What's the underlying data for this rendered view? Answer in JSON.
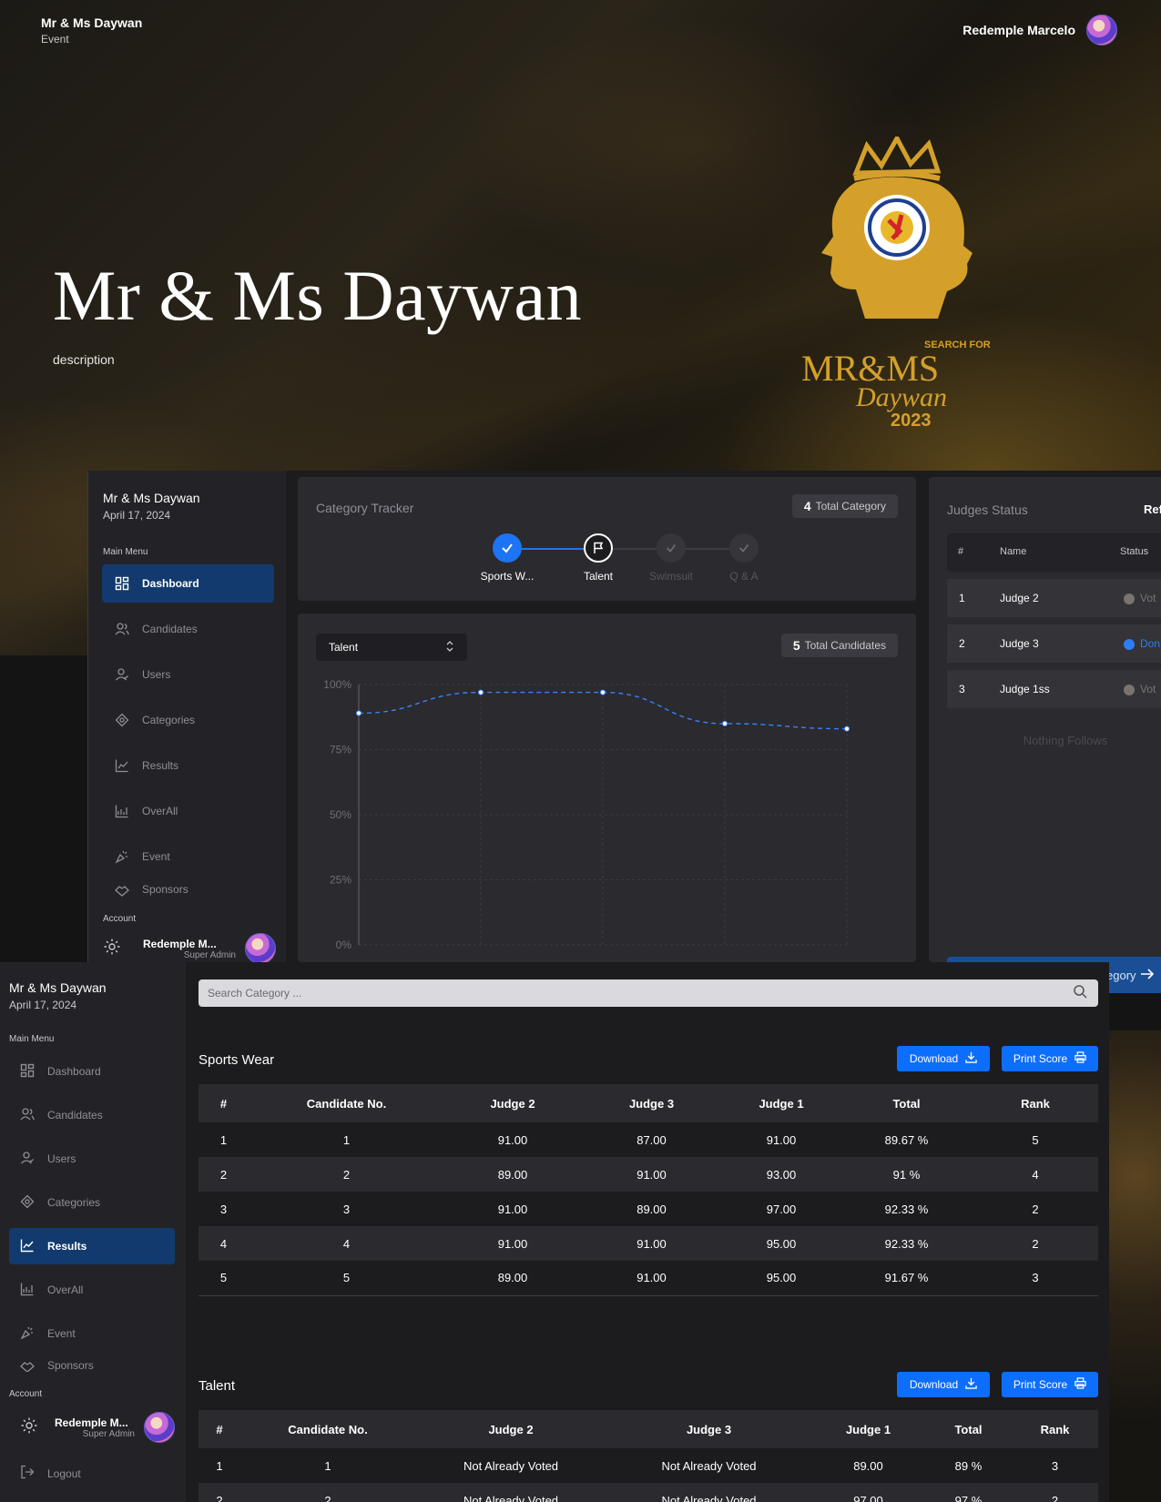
{
  "hero": {
    "brand_title": "Mr & Ms Daywan",
    "brand_sub": "Event",
    "user_name": "Redemple Marcelo",
    "title": "Mr & Ms Daywan",
    "description": "description",
    "logo": {
      "line1": "SEARCH FOR",
      "line2": "MR&MS",
      "line3": "Daywan",
      "year": "2023"
    }
  },
  "dashboard": {
    "app_title": "Mr & Ms Daywan",
    "app_date": "April 17, 2024",
    "main_menu_label": "Main Menu",
    "menu": [
      {
        "label": "Dashboard",
        "icon": "dashboard-icon"
      },
      {
        "label": "Candidates",
        "icon": "candidates-icon"
      },
      {
        "label": "Users",
        "icon": "users-icon"
      },
      {
        "label": "Categories",
        "icon": "categories-icon"
      },
      {
        "label": "Results",
        "icon": "results-icon"
      },
      {
        "label": "OverAll",
        "icon": "overall-icon"
      },
      {
        "label": "Event",
        "icon": "event-icon"
      },
      {
        "label": "Sponsors",
        "icon": "sponsors-icon"
      }
    ],
    "active_item": "Dashboard",
    "account_label": "Account",
    "account_name": "Redemple M...",
    "account_role": "Super Admin",
    "tracker": {
      "title": "Category Tracker",
      "total_count": "4",
      "total_label": "Total Category",
      "steps": [
        {
          "label": "Sports W...",
          "state": "done"
        },
        {
          "label": "Talent",
          "state": "current"
        },
        {
          "label": "Swimsuit",
          "state": "pending"
        },
        {
          "label": "Q & A",
          "state": "pending"
        }
      ]
    },
    "chart_card": {
      "selected_category": "Talent",
      "total_count": "5",
      "total_label": "Total Candidates"
    },
    "judges": {
      "title": "Judges Status",
      "refresh_label": "Ref",
      "headers": [
        "#",
        "Name",
        "Status"
      ],
      "rows": [
        {
          "num": "1",
          "name": "Judge 2",
          "status": "Vot",
          "status_color": "#7a746e"
        },
        {
          "num": "2",
          "name": "Judge 3",
          "status": "Don",
          "status_color": "#2f7df6"
        },
        {
          "num": "3",
          "name": "Judge 1ss",
          "status": "Vot",
          "status_color": "#7a746e"
        }
      ],
      "nothing_follows": "Nothing Follows",
      "next_button_label": "egory"
    }
  },
  "chart_data": {
    "type": "line",
    "x": [
      "1",
      "2",
      "3",
      "4",
      "5"
    ],
    "series": [
      {
        "values": [
          89,
          97,
          97,
          85,
          83
        ]
      }
    ],
    "y_tick_labels": [
      "100%",
      "75%",
      "50%",
      "25%",
      "0%"
    ],
    "ylim": [
      0,
      100
    ],
    "grid": true,
    "line_style": "dashed",
    "color": "#3b82f6"
  },
  "results": {
    "app_title": "Mr & Ms Daywan",
    "app_date": "April 17, 2024",
    "main_menu_label": "Main Menu",
    "menu": [
      {
        "label": "Dashboard"
      },
      {
        "label": "Candidates"
      },
      {
        "label": "Users"
      },
      {
        "label": "Categories"
      },
      {
        "label": "Results"
      },
      {
        "label": "OverAll"
      },
      {
        "label": "Event"
      },
      {
        "label": "Sponsors"
      }
    ],
    "active_item": "Results",
    "account_label": "Account",
    "account_name": "Redemple M...",
    "account_role": "Super Admin",
    "logout_label": "Logout",
    "search_placeholder": "Search Category ...",
    "download_label": "Download",
    "print_label": "Print Score",
    "sections": [
      {
        "title": "Sports Wear",
        "headers": [
          "#",
          "Candidate No.",
          "Judge 2",
          "Judge 3",
          "Judge 1",
          "Total",
          "Rank"
        ],
        "rows": [
          [
            "1",
            "1",
            "91.00",
            "87.00",
            "91.00",
            "89.67 %",
            "5"
          ],
          [
            "2",
            "2",
            "89.00",
            "91.00",
            "93.00",
            "91 %",
            "4"
          ],
          [
            "3",
            "3",
            "91.00",
            "89.00",
            "97.00",
            "92.33 %",
            "2"
          ],
          [
            "4",
            "4",
            "91.00",
            "91.00",
            "95.00",
            "92.33 %",
            "2"
          ],
          [
            "5",
            "5",
            "89.00",
            "91.00",
            "95.00",
            "91.67 %",
            "3"
          ]
        ]
      },
      {
        "title": "Talent",
        "headers": [
          "#",
          "Candidate No.",
          "Judge 2",
          "Judge 3",
          "Judge 1",
          "Total",
          "Rank"
        ],
        "rows": [
          [
            "1",
            "1",
            "Not Already Voted",
            "Not Already Voted",
            "89.00",
            "89 %",
            "3"
          ],
          [
            "2",
            "2",
            "Not Already Voted",
            "Not Already Voted",
            "97.00",
            "97 %",
            "2"
          ]
        ]
      }
    ]
  },
  "colors": {
    "accent": "#0d6efd",
    "active_nav": "#123a6e",
    "gold": "#d4a02a"
  }
}
